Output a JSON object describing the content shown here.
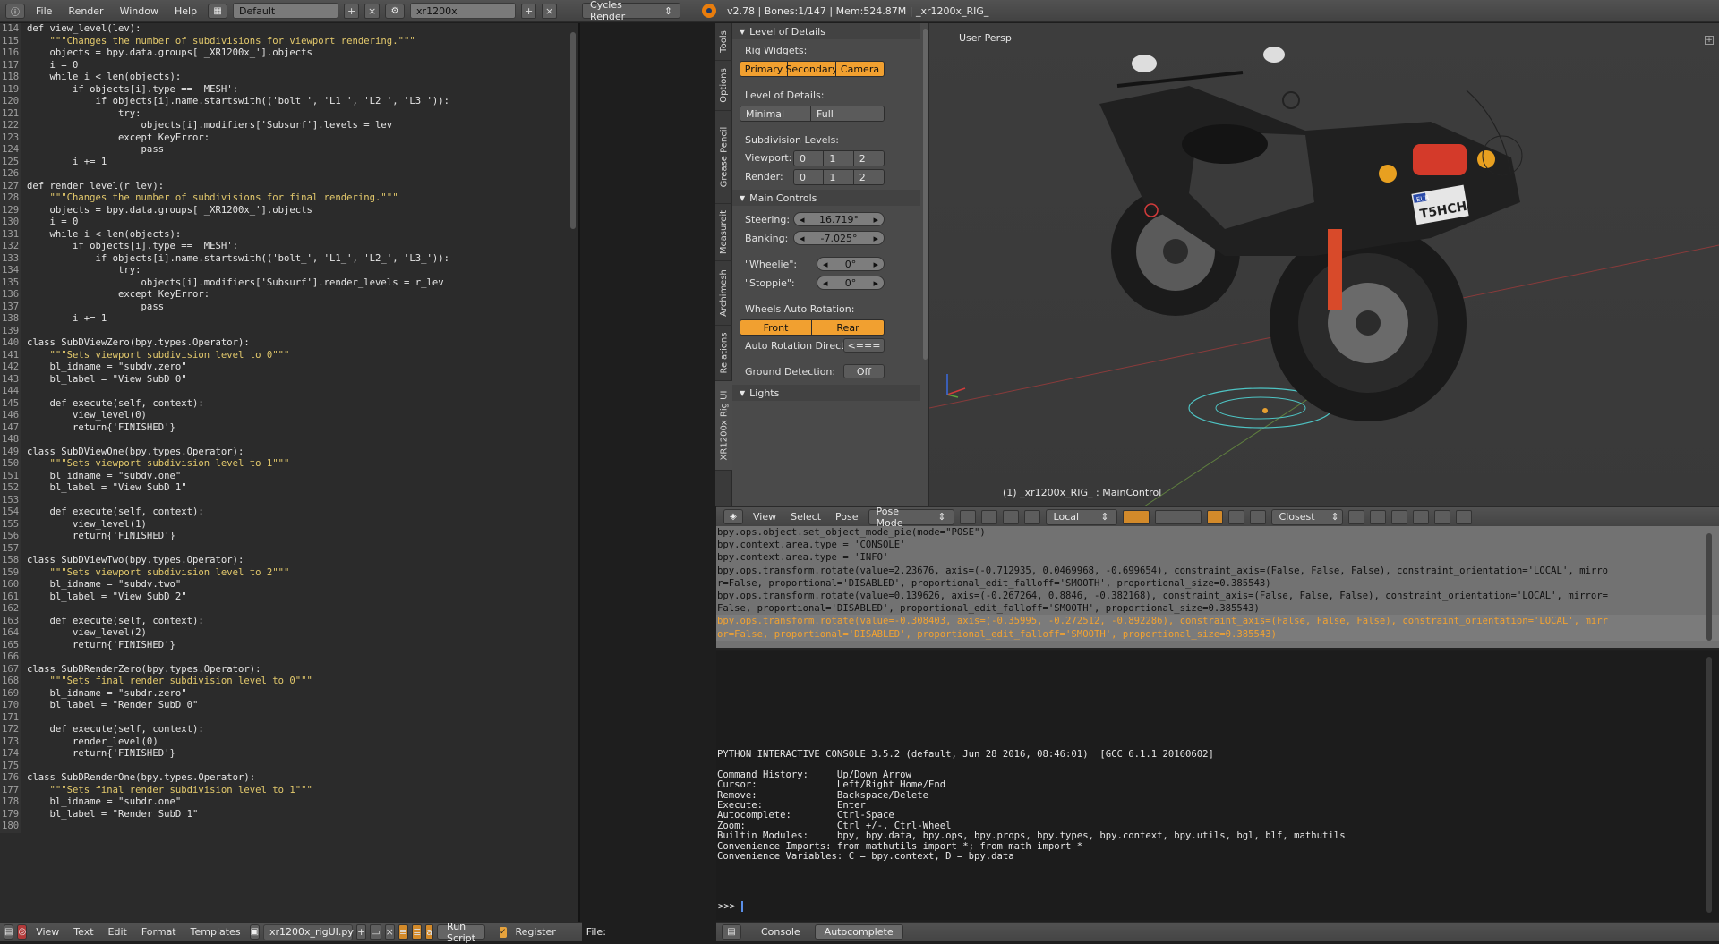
{
  "topbar": {
    "menus": [
      "File",
      "Render",
      "Window",
      "Help"
    ],
    "screen_layout": "Default",
    "scene": "xr1200x",
    "render_engine": "Cycles Render",
    "stats": "v2.78 | Bones:1/147  | Mem:524.87M | _xr1200x_RIG_"
  },
  "code_lines": [
    {
      "n": "114",
      "t": "def view_level(lev):"
    },
    {
      "n": "115",
      "t": "    \"\"\"Changes the number of subdivisions for viewport rendering.\"\"\""
    },
    {
      "n": "116",
      "t": "    objects = bpy.data.groups['_XR1200x_'].objects"
    },
    {
      "n": "117",
      "t": "    i = 0"
    },
    {
      "n": "118",
      "t": "    while i < len(objects):"
    },
    {
      "n": "119",
      "t": "        if objects[i].type == 'MESH':"
    },
    {
      "n": "120",
      "t": "            if objects[i].name.startswith(('bolt_', 'L1_', 'L2_', 'L3_')):"
    },
    {
      "n": "121",
      "t": "                try:"
    },
    {
      "n": "122",
      "t": "                    objects[i].modifiers['Subsurf'].levels = lev"
    },
    {
      "n": "123",
      "t": "                except KeyError:"
    },
    {
      "n": "124",
      "t": "                    pass"
    },
    {
      "n": "125",
      "t": "        i += 1"
    },
    {
      "n": "126",
      "t": ""
    },
    {
      "n": "127",
      "t": "def render_level(r_lev):"
    },
    {
      "n": "128",
      "t": "    \"\"\"Changes the number of subdivisions for final rendering.\"\"\""
    },
    {
      "n": "129",
      "t": "    objects = bpy.data.groups['_XR1200x_'].objects"
    },
    {
      "n": "130",
      "t": "    i = 0"
    },
    {
      "n": "131",
      "t": "    while i < len(objects):"
    },
    {
      "n": "132",
      "t": "        if objects[i].type == 'MESH':"
    },
    {
      "n": "133",
      "t": "            if objects[i].name.startswith(('bolt_', 'L1_', 'L2_', 'L3_')):"
    },
    {
      "n": "134",
      "t": "                try:"
    },
    {
      "n": "135",
      "t": "                    objects[i].modifiers['Subsurf'].render_levels = r_lev"
    },
    {
      "n": "136",
      "t": "                except KeyError:"
    },
    {
      "n": "137",
      "t": "                    pass"
    },
    {
      "n": "138",
      "t": "        i += 1"
    },
    {
      "n": "139",
      "t": ""
    },
    {
      "n": "140",
      "t": "class SubDViewZero(bpy.types.Operator):"
    },
    {
      "n": "141",
      "t": "    \"\"\"Sets viewport subdivision level to 0\"\"\""
    },
    {
      "n": "142",
      "t": "    bl_idname = \"subdv.zero\""
    },
    {
      "n": "143",
      "t": "    bl_label = \"View SubD 0\""
    },
    {
      "n": "144",
      "t": ""
    },
    {
      "n": "145",
      "t": "    def execute(self, context):"
    },
    {
      "n": "146",
      "t": "        view_level(0)"
    },
    {
      "n": "147",
      "t": "        return{'FINISHED'}"
    },
    {
      "n": "148",
      "t": ""
    },
    {
      "n": "149",
      "t": "class SubDViewOne(bpy.types.Operator):"
    },
    {
      "n": "150",
      "t": "    \"\"\"Sets viewport subdivision level to 1\"\"\""
    },
    {
      "n": "151",
      "t": "    bl_idname = \"subdv.one\""
    },
    {
      "n": "152",
      "t": "    bl_label = \"View SubD 1\""
    },
    {
      "n": "153",
      "t": ""
    },
    {
      "n": "154",
      "t": "    def execute(self, context):"
    },
    {
      "n": "155",
      "t": "        view_level(1)"
    },
    {
      "n": "156",
      "t": "        return{'FINISHED'}"
    },
    {
      "n": "157",
      "t": ""
    },
    {
      "n": "158",
      "t": "class SubDViewTwo(bpy.types.Operator):"
    },
    {
      "n": "159",
      "t": "    \"\"\"Sets viewport subdivision level to 2\"\"\""
    },
    {
      "n": "160",
      "t": "    bl_idname = \"subdv.two\""
    },
    {
      "n": "161",
      "t": "    bl_label = \"View SubD 2\""
    },
    {
      "n": "162",
      "t": ""
    },
    {
      "n": "163",
      "t": "    def execute(self, context):"
    },
    {
      "n": "164",
      "t": "        view_level(2)"
    },
    {
      "n": "165",
      "t": "        return{'FINISHED'}"
    },
    {
      "n": "166",
      "t": ""
    },
    {
      "n": "167",
      "t": "class SubDRenderZero(bpy.types.Operator):"
    },
    {
      "n": "168",
      "t": "    \"\"\"Sets final render subdivision level to 0\"\"\""
    },
    {
      "n": "169",
      "t": "    bl_idname = \"subdr.zero\""
    },
    {
      "n": "170",
      "t": "    bl_label = \"Render SubD 0\""
    },
    {
      "n": "171",
      "t": ""
    },
    {
      "n": "172",
      "t": "    def execute(self, context):"
    },
    {
      "n": "173",
      "t": "        render_level(0)"
    },
    {
      "n": "174",
      "t": "        return{'FINISHED'}"
    },
    {
      "n": "175",
      "t": ""
    },
    {
      "n": "176",
      "t": "class SubDRenderOne(bpy.types.Operator):"
    },
    {
      "n": "177",
      "t": "    \"\"\"Sets final render subdivision level to 1\"\"\""
    },
    {
      "n": "178",
      "t": "    bl_idname = \"subdr.one\""
    },
    {
      "n": "179",
      "t": "    bl_label = \"Render SubD 1\""
    },
    {
      "n": "180",
      "t": ""
    }
  ],
  "text_footer": {
    "menus": [
      "View",
      "Text",
      "Edit",
      "Format",
      "Templates"
    ],
    "filename": "xr1200x_rigUI.py",
    "run_script": "Run Script",
    "register": "Register",
    "file_label": "File:"
  },
  "tool_tabs": [
    "Tools",
    "Options",
    "Grease Pencil",
    "Measureit",
    "Archimesh",
    "Relations",
    "XR1200x Rig UI"
  ],
  "rig_panel": {
    "level_of_details_header": "Level of Details",
    "rig_widgets_label": "Rig Widgets:",
    "rig_widgets": [
      "Primary",
      "Secondary",
      "Camera"
    ],
    "level_of_details_label": "Level of Details:",
    "lod_options": [
      "Minimal",
      "Full"
    ],
    "subdivision_label": "Subdivision Levels:",
    "viewport_label": "Viewport:",
    "render_label": "Render:",
    "levels": [
      "0",
      "1",
      "2"
    ],
    "main_controls_header": "Main Controls",
    "steering_label": "Steering:",
    "steering_value": "16.719°",
    "banking_label": "Banking:",
    "banking_value": "-7.025°",
    "wheelie_label": "\"Wheelie\":",
    "wheelie_value": "0°",
    "stoppie_label": "\"Stoppie\":",
    "stoppie_value": "0°",
    "wheels_rotation_label": "Wheels Auto Rotation:",
    "wheels": [
      "Front",
      "Rear"
    ],
    "direction_label": "Auto Rotation Direction:",
    "direction_value": "<===",
    "ground_label": "Ground Detection:",
    "ground_value": "Off",
    "lights_header": "Lights"
  },
  "viewport": {
    "view_label": "User Persp",
    "object_label": "(1) _xr1200x_RIG_ : MainControl",
    "plate_top": "EUR",
    "plate_text": "T5HCH"
  },
  "viewport_header": {
    "menus": [
      "View",
      "Select",
      "Pose"
    ],
    "mode": "Pose Mode",
    "orientation": "Local",
    "snap": "Closest"
  },
  "info_log": [
    {
      "t": "bpy.ops.object.set_object_mode_pie(mode=\"POSE\")",
      "hl": false
    },
    {
      "t": "bpy.context.area.type = 'CONSOLE'",
      "hl": false
    },
    {
      "t": "bpy.context.area.type = 'INFO'",
      "hl": false
    },
    {
      "t": "bpy.ops.transform.rotate(value=2.23676, axis=(-0.712935, 0.0469968, -0.699654), constraint_axis=(False, False, False), constraint_orientation='LOCAL', mirro",
      "hl": false
    },
    {
      "t": "r=False, proportional='DISABLED', proportional_edit_falloff='SMOOTH', proportional_size=0.385543)",
      "hl": false
    },
    {
      "t": "bpy.ops.transform.rotate(value=0.139626, axis=(-0.267264, 0.8846, -0.382168), constraint_axis=(False, False, False), constraint_orientation='LOCAL', mirror=",
      "hl": false
    },
    {
      "t": "False, proportional='DISABLED', proportional_edit_falloff='SMOOTH', proportional_size=0.385543)",
      "hl": false
    },
    {
      "t": "bpy.ops.transform.rotate(value=-0.308403, axis=(-0.35995, -0.272512, -0.892286), constraint_axis=(False, False, False), constraint_orientation='LOCAL', mirr",
      "hl": true
    },
    {
      "t": "or=False, proportional='DISABLED', proportional_edit_falloff='SMOOTH', proportional_size=0.385543)",
      "hl": true
    }
  ],
  "console_lines": [
    "PYTHON INTERACTIVE CONSOLE 3.5.2 (default, Jun 28 2016, 08:46:01)  [GCC 6.1.1 20160602]",
    "",
    "Command History:     Up/Down Arrow",
    "Cursor:              Left/Right Home/End",
    "Remove:              Backspace/Delete",
    "Execute:             Enter",
    "Autocomplete:        Ctrl-Space",
    "Zoom:                Ctrl +/-, Ctrl-Wheel",
    "Builtin Modules:     bpy, bpy.data, bpy.ops, bpy.props, bpy.types, bpy.context, bpy.utils, bgl, blf, mathutils",
    "Convenience Imports: from mathutils import *; from math import *",
    "Convenience Variables: C = bpy.context, D = bpy.data"
  ],
  "console_prompt": ">>> ",
  "console_footer": {
    "tabs": [
      "Console",
      "Autocomplete"
    ]
  }
}
